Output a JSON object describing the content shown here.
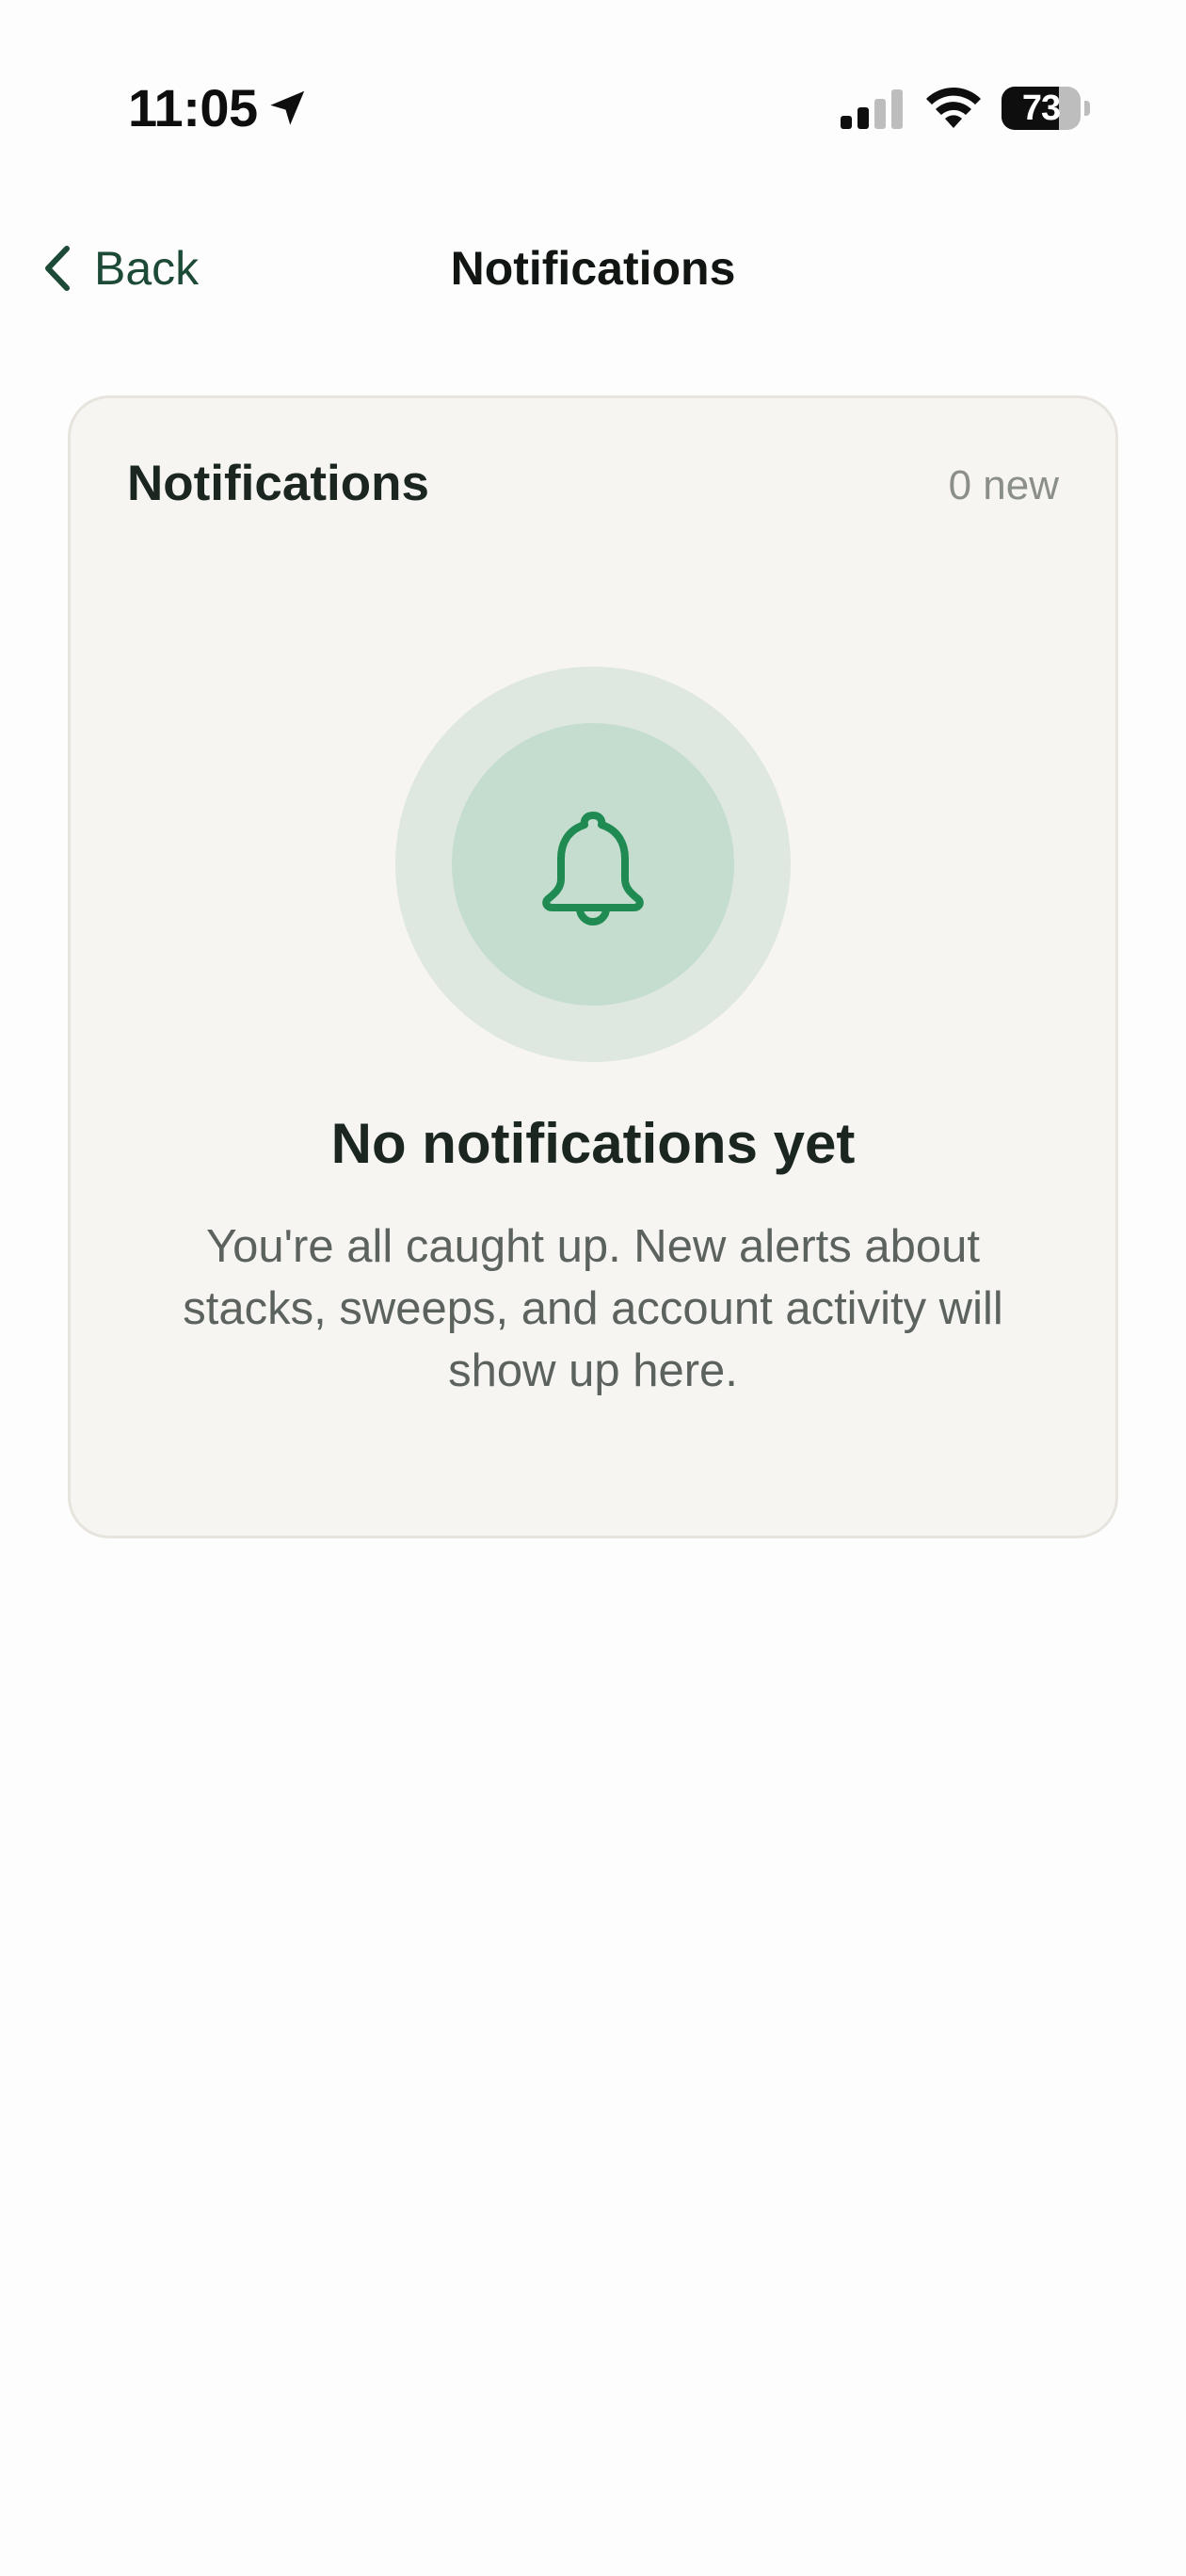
{
  "status_bar": {
    "time": "11:05",
    "battery_percent": "73",
    "battery_level": 0.73,
    "signal_bars_active": 2,
    "signal_bars_total": 4
  },
  "nav": {
    "back_label": "Back",
    "title": "Notifications"
  },
  "card": {
    "title": "Notifications",
    "count_label": "0 new",
    "empty_title": "No notifications yet",
    "empty_message": "You're all caught up. New alerts about stacks, sweeps, and account activity will show up here."
  },
  "colors": {
    "accent": "#1f8a52",
    "back_text": "#1d4a36",
    "card_background": "#f6f5f2",
    "ring_outer": "#dfe8e0",
    "ring_inner": "#c5ddce"
  },
  "icons": {
    "location": "location-arrow-icon",
    "signal": "cellular-signal-icon",
    "wifi": "wifi-icon",
    "battery": "battery-icon",
    "back": "chevron-left-icon",
    "empty_state": "bell-icon"
  }
}
